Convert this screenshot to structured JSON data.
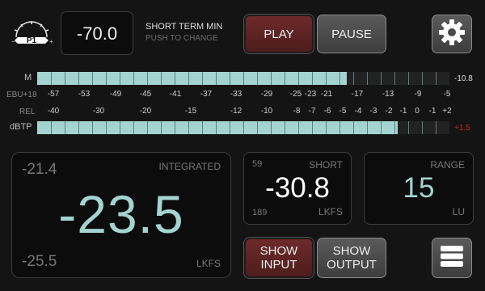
{
  "preset": {
    "badge": "P1"
  },
  "short_term_min": {
    "value": "-70.0",
    "title": "SHORT TERM MIN",
    "hint": "PUSH TO CHANGE"
  },
  "transport": {
    "play": "PLAY",
    "pause": "PAUSE"
  },
  "icons": {
    "settings": "gear-icon",
    "menu": "menu-icon"
  },
  "meters": {
    "m": {
      "label": "M",
      "readout": "-10.8",
      "level_fraction": 0.75
    },
    "dbtp": {
      "label": "dBTP",
      "readout": "+1.5",
      "level_fraction": 0.875,
      "readout_color": "#cc2222"
    },
    "ebu_label": "EBU+18",
    "rel_label": "REL",
    "ebu_scale": [
      "-57",
      "-53",
      "-49",
      "-45",
      "-41",
      "-37",
      "-33",
      "-29",
      "-25",
      "-23",
      "-21",
      "-17",
      "-13",
      "-9",
      "-5"
    ],
    "rel_scale": [
      "-40",
      "-30",
      "-20",
      "-15",
      "-12",
      "-10",
      "-8",
      "-7",
      "-6",
      "-5",
      "-4",
      "-3",
      "-2",
      "-1",
      "0",
      "-1",
      "+2"
    ]
  },
  "integrated": {
    "label": "INTEGRATED",
    "value": "-23.5",
    "max": "-21.4",
    "min": "-25.5",
    "unit": "LKFS"
  },
  "short": {
    "label": "SHORT",
    "value": "-30.8",
    "top_left": "59",
    "bottom_left": "189",
    "unit": "LKFS"
  },
  "range": {
    "label": "RANGE",
    "value": "15",
    "unit": "LU"
  },
  "show": {
    "input": "SHOW INPUT",
    "output": "SHOW OUTPUT"
  },
  "colors": {
    "accent": "#a4d4d0",
    "play_bg": "#5e2424",
    "alert": "#cc2222"
  }
}
